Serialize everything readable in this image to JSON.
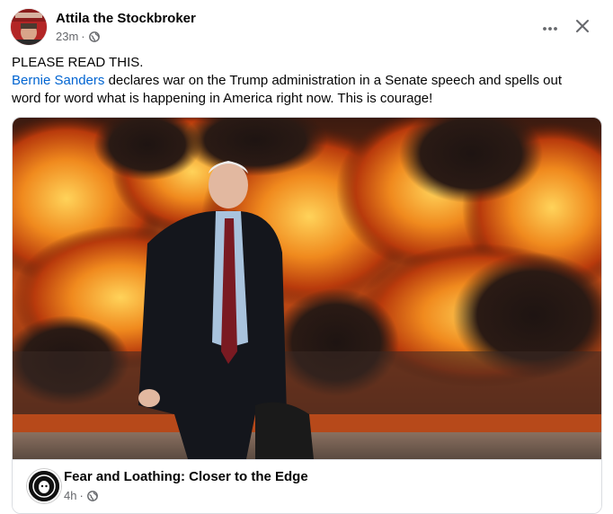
{
  "post": {
    "author": "Attila the Stockbroker",
    "time": "23m",
    "separator": "·",
    "privacy_icon": "globe-icon",
    "more_icon": "ellipsis-icon",
    "close_icon": "close-icon",
    "text_line1": "PLEASE READ THIS.",
    "mention": "Bernie Sanders",
    "text_line2_rest": " declares war on the Trump administration in a Senate speech and spells out",
    "text_line3": "word for word  what is happening in America right now. This is courage!"
  },
  "shared": {
    "image_subject": "man walking in front of explosions",
    "page_name": "Fear and Loathing: Closer to the Edge",
    "time": "4h",
    "separator": "·",
    "privacy_icon": "globe-icon"
  },
  "colors": {
    "mention": "#0064d1",
    "meta_text": "#65676b",
    "border": "#dadde1"
  }
}
